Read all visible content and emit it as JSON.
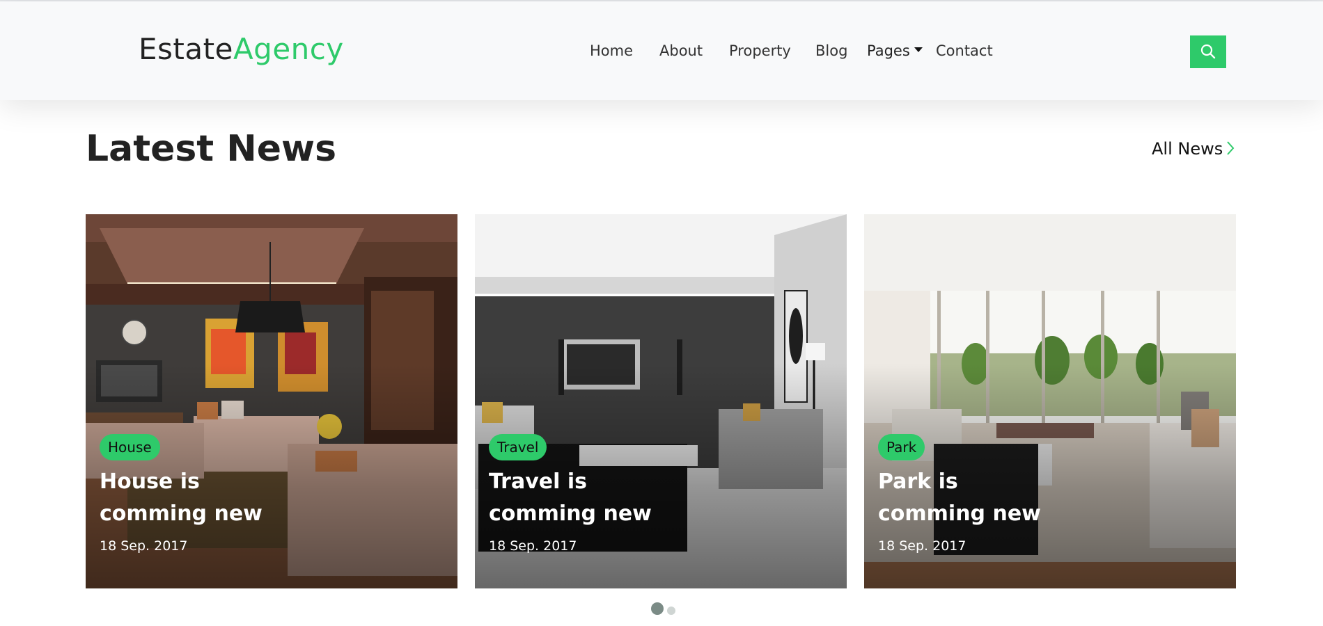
{
  "brand": {
    "part1": "Estate",
    "part2": "Agency"
  },
  "nav": {
    "items": [
      "Home",
      "About",
      "Property",
      "Blog",
      "Pages",
      "Contact"
    ]
  },
  "header": {
    "search_icon": "search-icon"
  },
  "section": {
    "title": "Latest News",
    "all_link": "All News",
    "all_icon": "chevron-right-icon"
  },
  "cards": [
    {
      "badge": "House",
      "title_line1": "House is",
      "title_line2": "comming new",
      "date": "18 Sep. 2017",
      "image": "warm living room interior photo"
    },
    {
      "badge": "Travel",
      "title_line1": "Travel is",
      "title_line2": "comming new",
      "date": "18 Sep. 2017",
      "image": "grey modern living room photo"
    },
    {
      "badge": "Park",
      "title_line1": "Park is",
      "title_line2": "comming new",
      "date": "18 Sep. 2017",
      "image": "bright open-plan living room photo"
    }
  ],
  "pagination": {
    "pages": 2,
    "active": 1
  },
  "colors": {
    "accent": "#2eca6a",
    "header_bg": "#f8f9fa",
    "text": "#222222"
  }
}
